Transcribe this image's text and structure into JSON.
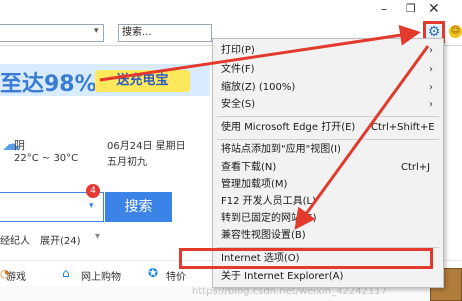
{
  "browser": {
    "window_controls": {
      "minimize": "–",
      "restore": "❐",
      "close": "✕"
    },
    "address_dropdown": "▾",
    "search_placeholder": "搜索...",
    "toolbar_icons": "☆",
    "tools_icon": "gear-icon",
    "feedback_icon": "smiley-icon"
  },
  "page": {
    "promo_text": "至达98%",
    "promo_button": "送充电宝",
    "weather": {
      "condition": "阴",
      "temperature": "22°C ~ 30°C"
    },
    "date": "06月24日 星期日",
    "lunar": "五月初九",
    "search_badge": "4",
    "search_button": "搜索",
    "links": {
      "a": "经纪人",
      "b": "展开(24)",
      "c": "▾"
    },
    "nav": {
      "game": "游戏",
      "shop": "网上购物",
      "deal": "特价"
    },
    "watermark": "https://blog.csdn.net/weixin_42242117"
  },
  "menu": {
    "items": [
      {
        "label": "打印(P)",
        "arrow": "›"
      },
      {
        "label": "文件(F)",
        "arrow": "›"
      },
      {
        "label": "缩放(Z) (100%)",
        "arrow": "›"
      },
      {
        "label": "安全(S)",
        "arrow": "›"
      },
      {
        "label": "使用 Microsoft Edge 打开(E)",
        "shortcut": "Ctrl+Shift+E"
      },
      {
        "label": "将站点添加到\"应用\"视图(I)"
      },
      {
        "label": "查看下载(N)",
        "shortcut": "Ctrl+J"
      },
      {
        "label": "管理加载项(M)"
      },
      {
        "label": "F12 开发人员工具(L)"
      },
      {
        "label": "转到已固定的网站(G)"
      },
      {
        "label": "兼容性视图设置(B)"
      },
      {
        "label": "Internet 选项(O)"
      },
      {
        "label": "关于 Internet Explorer(A)"
      }
    ]
  },
  "annotation_colors": {
    "highlight": "#e23b2e"
  }
}
